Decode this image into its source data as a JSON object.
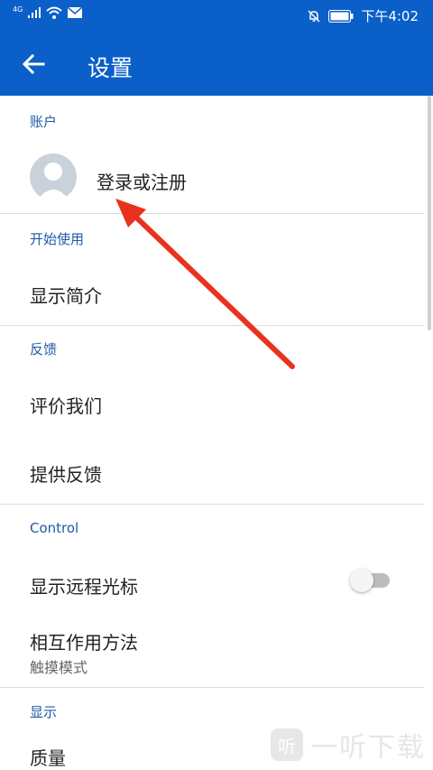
{
  "status_bar": {
    "network": "4G",
    "time": "下午4:02",
    "icons": [
      "signal-icon",
      "wifi-icon",
      "mail-icon",
      "mute-icon",
      "battery-icon"
    ]
  },
  "toolbar": {
    "title": "设置",
    "back_icon": "back-arrow-icon"
  },
  "colors": {
    "appbar": "#0a5fc9",
    "section_header": "#1f5aa8",
    "annotation_arrow": "#e8321e"
  },
  "sections": {
    "account": {
      "header": "账户",
      "login_label": "登录或注册"
    },
    "getting_started": {
      "header": "开始使用",
      "show_intro": "显示简介"
    },
    "feedback": {
      "header": "反馈",
      "rate_us": "评价我们",
      "give_feedback": "提供反馈"
    },
    "control": {
      "header": "Control",
      "show_remote_cursor": "显示远程光标",
      "remote_cursor_enabled": false,
      "interaction_method": "相互作用方法",
      "interaction_value": "触摸模式"
    },
    "display": {
      "header": "显示",
      "quality": "质量"
    }
  },
  "watermark": {
    "logo_char": "听",
    "text": "一听下载"
  }
}
